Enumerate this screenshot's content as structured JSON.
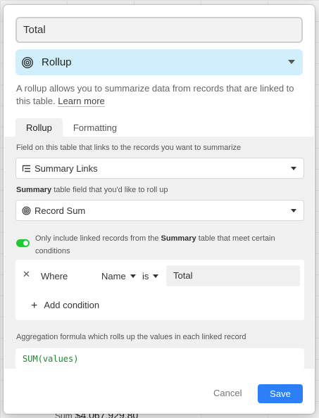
{
  "background": {
    "footer_prefix": "Sum",
    "footer_amount": "$4,067,929.80"
  },
  "field": {
    "name_value": "Total",
    "type_label": "Rollup",
    "type_icon": "rollup-icon",
    "description": "A rollup allows you to summarize data from records that are linked to this table.",
    "learn_more": "Learn more"
  },
  "tabs": [
    {
      "label": "Rollup",
      "active": true
    },
    {
      "label": "Formatting",
      "active": false
    }
  ],
  "rollup": {
    "link_field_label": "Field on this table that links to the records you want to summarize",
    "link_field_value": "Summary Links",
    "link_field_icon": "linked-records-icon",
    "rollup_field_label_bold": "Summary",
    "rollup_field_label_rest": " table field that you'd like to roll up",
    "rollup_field_value": "Record Sum",
    "rollup_field_icon": "rollup-icon",
    "filter_enabled": true,
    "filter_text_1": "Only include linked records from the ",
    "filter_text_bold": "Summary",
    "filter_text_2": " table that meet certain conditions",
    "condition": {
      "where": "Where",
      "field": "Name",
      "operator": "is",
      "value": "Total"
    },
    "add_condition": "Add condition",
    "aggregation_label": "Aggregation formula which rolls up the values in each linked record",
    "aggregation_formula": "SUM(values)"
  },
  "actions": {
    "cancel": "Cancel",
    "save": "Save"
  },
  "colors": {
    "accent": "#2d7ff9",
    "type_bg": "#d1eefc",
    "toggle_on": "#20c933",
    "formula_text": "#168a2c"
  }
}
